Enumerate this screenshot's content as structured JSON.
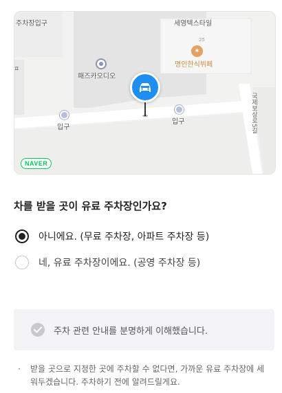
{
  "map": {
    "labels": {
      "parking_entrance": "주차장입구",
      "building": "세영텍스타일",
      "studio": "패즈카오디오",
      "restaurant": "명인한식뷔페",
      "entrance_left": "입구",
      "entrance_right": "입구",
      "road": "국제보상로5길",
      "side_mark": "ㅍ",
      "bldg_number": "25"
    },
    "brand_badge": "NAVER",
    "icons": {
      "car": "car-icon",
      "restaurant": "fork-knife-icon",
      "poi": "map-poi-icon",
      "entrance": "entrance-dot-icon"
    }
  },
  "question": {
    "title": "차를 받을 곳이 유료 주차장인가요?",
    "options": [
      {
        "label": "아니에요. (무료 주차장, 아파트 주차장 등)",
        "selected": true
      },
      {
        "label": "네, 유료 주차장이에요. (공영 주차장 등)",
        "selected": false
      }
    ]
  },
  "confirm": {
    "label": "주차 관련 안내를 분명하게 이해했습니다.",
    "checked": false,
    "icon": "check-circle-icon"
  },
  "note": {
    "bullet": "·",
    "text": "받을 곳으로 지정한 곳에 주차할 수 없다면, 가까운 유료 주차장에 세워두겠습니다. 주차하기 전에 알려드릴게요."
  },
  "colors": {
    "accent_blue": "#1e8ff0",
    "naver_green": "#03c75a",
    "restaurant_orange": "#e3a261",
    "confirm_bg": "#f4f4f6"
  }
}
